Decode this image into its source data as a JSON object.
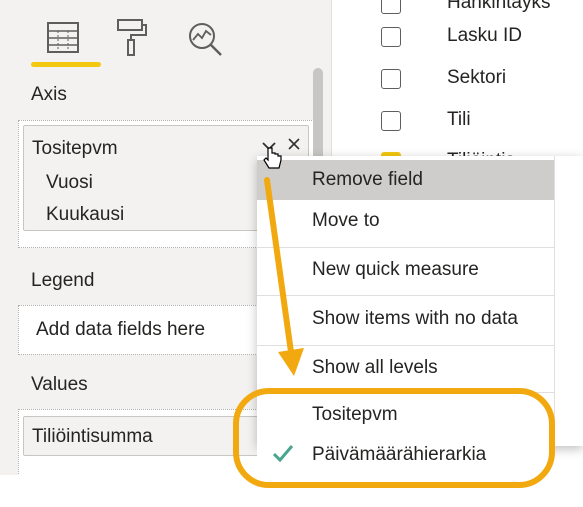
{
  "left_pane": {
    "tabs": [
      {
        "name": "fields",
        "icon": "table-grid-icon",
        "active": true
      },
      {
        "name": "format",
        "icon": "paint-roller-icon",
        "active": false
      },
      {
        "name": "analytics",
        "icon": "magnifier-chart-icon",
        "active": false
      }
    ],
    "axis": {
      "label": "Axis",
      "field": "Tositepvm",
      "levels": [
        "Vuosi",
        "Kuukausi"
      ]
    },
    "legend": {
      "label": "Legend",
      "placeholder": "Add data fields here"
    },
    "values": {
      "label": "Values",
      "field": "Tiliöintisumma"
    }
  },
  "fields_list": {
    "items": [
      {
        "label": "Hankintayks",
        "checked": false
      },
      {
        "label": "Lasku ID",
        "checked": false
      },
      {
        "label": "Sektori",
        "checked": false
      },
      {
        "label": "Tili",
        "checked": false
      },
      {
        "label": "Tiliöintis",
        "checked": true
      }
    ]
  },
  "context_menu": {
    "items": [
      {
        "label": "Remove field",
        "highlighted": true
      },
      {
        "label": "Move to",
        "highlighted": false
      },
      {
        "label": "New quick measure",
        "highlighted": false
      },
      {
        "label": "Show items with no data",
        "highlighted": false
      },
      {
        "label": "Show all levels",
        "highlighted": false
      }
    ],
    "options": [
      {
        "label": "Tositepvm",
        "checked": false
      },
      {
        "label": "Päivämäärähierarkia",
        "checked": true
      }
    ]
  },
  "colors": {
    "accent_yellow": "#f2c811",
    "callout_orange": "#f2a90f",
    "check_green": "#4aa58f"
  }
}
